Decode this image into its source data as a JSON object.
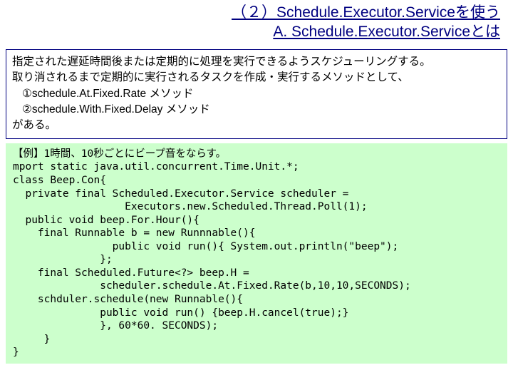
{
  "title": "（２）Schedule.Executor.Serviceを使う",
  "subtitle": "A. Schedule.Executor.Serviceとは",
  "description": {
    "line1": "指定された遅延時間後または定期的に処理を実行できるようスケジューリングする。",
    "line2": "取り消されるまで定期的に実行されるタスクを作成・実行するメソッドとして、",
    "method1": "①schedule.At.Fixed.Rate メソッド",
    "method2": "②schedule.With.Fixed.Delay メソッド",
    "line3": "がある。"
  },
  "code": "【例】1時間、10秒ごとにビープ音をならす。\nmport static java.util.concurrent.Time.Unit.*;\nclass Beep.Con{\n  private final Scheduled.Executor.Service scheduler =\n                  Executors.new.Scheduled.Thread.Poll(1);\n  public void beep.For.Hour(){\n    final Runnable b = new Runnnable(){\n                public void run(){ System.out.println(\"beep\");\n              };\n    final Scheduled.Future<?> beep.H =\n              scheduler.schedule.At.Fixed.Rate(b,10,10,SECONDS);\n    schduler.schedule(new Runnable(){\n              public void run() {beep.H.cancel(true);}\n              }, 60*60. SECONDS);\n     }\n}"
}
